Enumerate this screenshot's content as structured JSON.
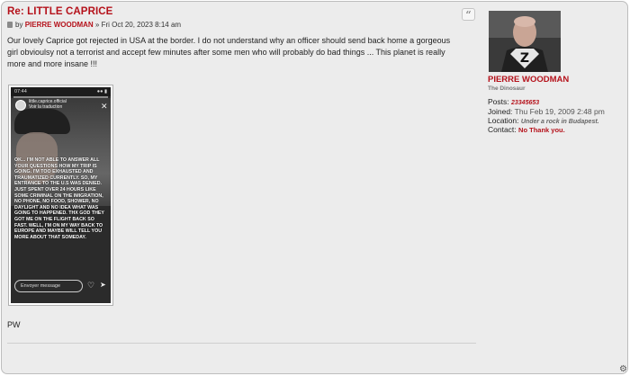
{
  "post": {
    "title": "Re: LITTLE CAPRICE",
    "by_prefix": "by",
    "author": "PIERRE WOODMAN",
    "date": "» Fri Oct 20, 2023 8:14 am",
    "quote_icon": "quote-icon",
    "content": "Our lovely Caprice got rejected in USA at the border. I do not understand why an officer should send back home a gorgeous girl obvioulsy not a terrorist and accept few minutes after some men who will probably do bad things ... This planet is really more and more insane !!!",
    "signature": "PW"
  },
  "story": {
    "time": "07:44",
    "account": "little.caprice.official",
    "translation": "Voir la traduction",
    "text": "OK... I'M NOT ABLE TO ANSWER ALL YOUR QUESTIONS HOW MY TRIP IS GOING. I'M TOO EXHAUSTED AND TRAUMATIZED CURRENTLY. SO, MY ENTRANCE TO THE U.S WAS DENIED. JUST SPENT OVER 24 HOURS LIKE SOME CRIMINAL ON THE IMIGRATION, NO PHONE, NO FOOD, SHOWER, NO DAYLIGHT AND NO IDEA WHAT WAS GOING TO HAPPENED. THX GOD THEY GOT ME ON THE FLIGHT BACK SO FAST. WELL, I'M ON MY WAY BACK TO EUROPE AND MAYBE WILL TELL YOU MORE ABOUT THAT SOMEDAY.",
    "message_placeholder": "Envoyer message"
  },
  "profile": {
    "name": "PIERRE WOODMAN",
    "rank": "The Dinosaur",
    "posts_label": "Posts:",
    "posts_value": "23345653",
    "joined_label": "Joined:",
    "joined_value": "Thu Feb 19, 2009 2:48 pm",
    "location_label": "Location:",
    "location_value": "Under a rock in Budapest.",
    "contact_label": "Contact:",
    "contact_value": "No Thank you."
  },
  "colors": {
    "accent": "#b5121b",
    "panel": "#ececec"
  }
}
